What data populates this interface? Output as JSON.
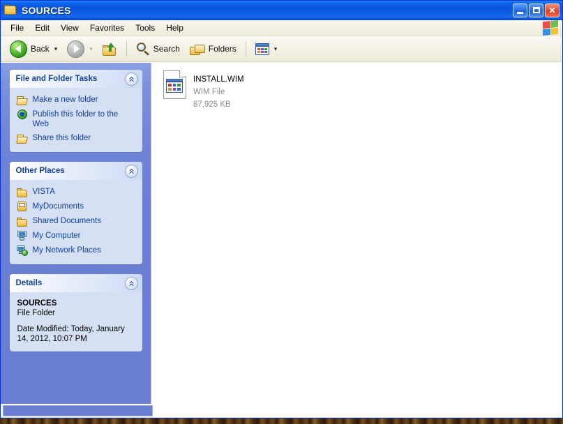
{
  "window": {
    "title": "SOURCES",
    "title_icon": "folder-icon",
    "minimize_label": "Minimize",
    "maximize_label": "Maximize",
    "close_label": "Close"
  },
  "menubar": {
    "items": [
      {
        "label": "File"
      },
      {
        "label": "Edit"
      },
      {
        "label": "View"
      },
      {
        "label": "Favorites"
      },
      {
        "label": "Tools"
      },
      {
        "label": "Help"
      }
    ],
    "brand_icon": "windows-flag-icon"
  },
  "toolbar": {
    "back_label": "Back",
    "back_icon": "back-arrow-icon",
    "back_dropdown_icon": "chevron-down-icon",
    "forward_icon": "forward-arrow-icon",
    "forward_dropdown_icon": "chevron-down-icon",
    "up_icon": "up-folder-icon",
    "search_label": "Search",
    "search_icon": "magnifier-icon",
    "folders_label": "Folders",
    "folders_icon": "folders-icon",
    "views_icon": "views-icon",
    "views_dropdown_icon": "chevron-down-icon"
  },
  "sidebar": {
    "panels": [
      {
        "title": "File and Folder Tasks",
        "collapse_icon": "double-chevron-up-icon",
        "items": [
          {
            "label": "Make a new folder",
            "icon": "new-folder-icon"
          },
          {
            "label": "Publish this folder to the Web",
            "icon": "publish-globe-icon"
          },
          {
            "label": "Share this folder",
            "icon": "share-folder-icon"
          }
        ]
      },
      {
        "title": "Other Places",
        "collapse_icon": "double-chevron-up-icon",
        "items": [
          {
            "label": "VISTA",
            "icon": "folder-icon"
          },
          {
            "label": "MyDocuments",
            "icon": "documents-icon"
          },
          {
            "label": "Shared Documents",
            "icon": "folder-icon"
          },
          {
            "label": "My Computer",
            "icon": "computer-icon"
          },
          {
            "label": "My Network Places",
            "icon": "network-places-icon"
          }
        ]
      },
      {
        "title": "Details",
        "collapse_icon": "double-chevron-up-icon",
        "details": {
          "name": "SOURCES",
          "type": "File Folder",
          "modified": "Date Modified: Today, January 14, 2012, 10:07 PM"
        }
      }
    ]
  },
  "content": {
    "files": [
      {
        "name": "INSTALL.WIM",
        "type": "WIM File",
        "size": "87,925 KB",
        "icon": "generic-file-icon"
      }
    ]
  },
  "colors": {
    "titlebar_blue": "#0a52dd",
    "sidebar_blue": "#6a7fd4",
    "panel_body": "#d6e0f5",
    "link_blue": "#0f3f9e",
    "panel_title": "#14429c",
    "close_red": "#e0412a"
  }
}
